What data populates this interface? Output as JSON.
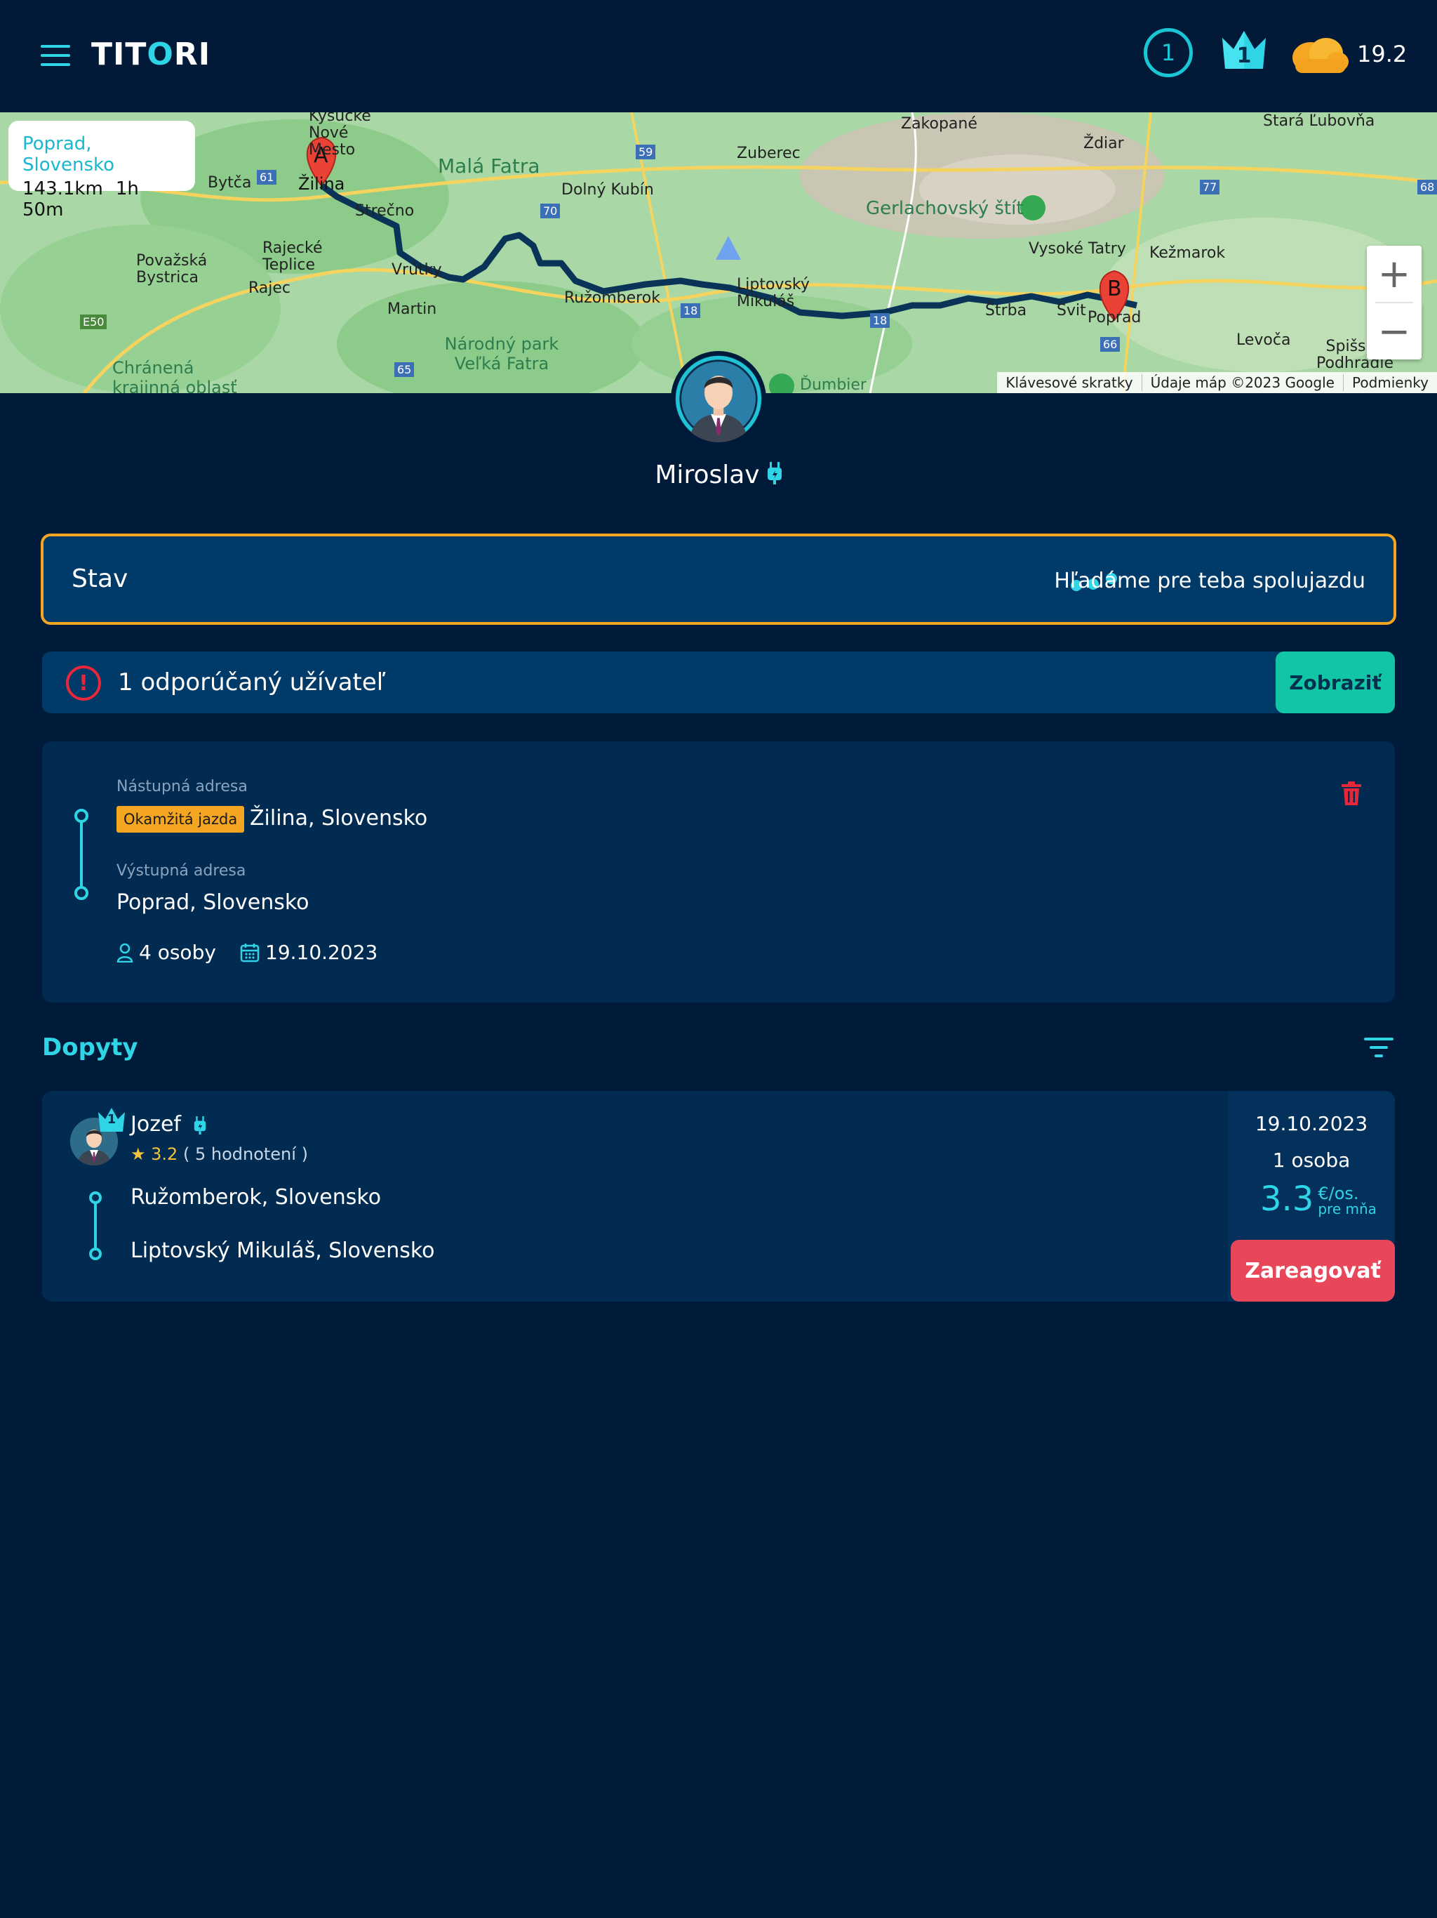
{
  "header": {
    "logo": "TITORI",
    "level": "1",
    "crown_rank": "1",
    "temperature": "19.2",
    "icons": [
      "menu-icon",
      "level-ring-icon",
      "crown-icon",
      "weather-cloud-icon"
    ]
  },
  "map": {
    "route_card": {
      "destination": "Poprad, Slovensko",
      "distance": "143.1km",
      "duration": "1h 50m"
    },
    "marker_a": "A",
    "marker_b": "B",
    "zoom_in": "+",
    "zoom_out": "−",
    "attribution": {
      "shortcuts": "Klávesové skratky",
      "data": "Údaje máp ©2023 Google",
      "terms": "Podmienky"
    },
    "google_logo": "Google",
    "places": [
      {
        "name": "Kysucké Nové Mesto"
      },
      {
        "name": "Žilina"
      },
      {
        "name": "Bytča"
      },
      {
        "name": "Malá Fatra"
      },
      {
        "name": "Strečno"
      },
      {
        "name": "Považská Bystrica"
      },
      {
        "name": "Rajecké Teplice"
      },
      {
        "name": "Rajec"
      },
      {
        "name": "Vrútky"
      },
      {
        "name": "Martin"
      },
      {
        "name": "Dolný Kubín"
      },
      {
        "name": "Zuberec"
      },
      {
        "name": "Zakopané"
      },
      {
        "name": "Ždiar"
      },
      {
        "name": "Stará Ľubovňa"
      },
      {
        "name": "Gerlachovský štít"
      },
      {
        "name": "Vysoké Tatry"
      },
      {
        "name": "Kežmarok"
      },
      {
        "name": "Ružomberok"
      },
      {
        "name": "Liptovský Mikuláš"
      },
      {
        "name": "Štrba"
      },
      {
        "name": "Svit"
      },
      {
        "name": "Poprad"
      },
      {
        "name": "Levoča"
      },
      {
        "name": "Spišské Podhradie"
      },
      {
        "name": "Národný park Veľká Fatra"
      },
      {
        "name": "Chránená krajinná oblasť"
      },
      {
        "name": "Ďumbier"
      }
    ],
    "road_numbers": [
      "61",
      "59",
      "70",
      "77",
      "68",
      "E50",
      "18",
      "18",
      "65",
      "66"
    ]
  },
  "profile": {
    "name": "Miroslav"
  },
  "status": {
    "label": "Stav",
    "text": "Hľadáme pre teba spolujazdu"
  },
  "recommended": {
    "text": "1 odporúčaný užívateľ",
    "button": "Zobraziť"
  },
  "trip": {
    "from_label": "Nástupná adresa",
    "badge": "Okamžitá jazda",
    "from": "Žilina, Slovensko",
    "to_label": "Výstupná adresa",
    "to": "Poprad, Slovensko",
    "persons": "4 osoby",
    "date": "19.10.2023"
  },
  "requests": {
    "title": "Dopyty",
    "items": [
      {
        "name": "Jozef",
        "crown_rank": "1",
        "rating": "3.2",
        "reviews": "( 5 hodnotení )",
        "from": "Ružomberok, Slovensko",
        "to": "Liptovský Mikuláš, Slovensko",
        "date": "19.10.2023",
        "seats": "1 osoba",
        "price": "3.3",
        "price_unit": "€/os.",
        "price_note": "pre mňa",
        "button": "Zareagovať"
      }
    ]
  },
  "colors": {
    "background": "#001a3a",
    "accent": "#2fd4e6",
    "status_border": "#f4a623",
    "reco_button": "#12c6a5",
    "react_button": "#e8475a",
    "alert": "#e8273a"
  }
}
